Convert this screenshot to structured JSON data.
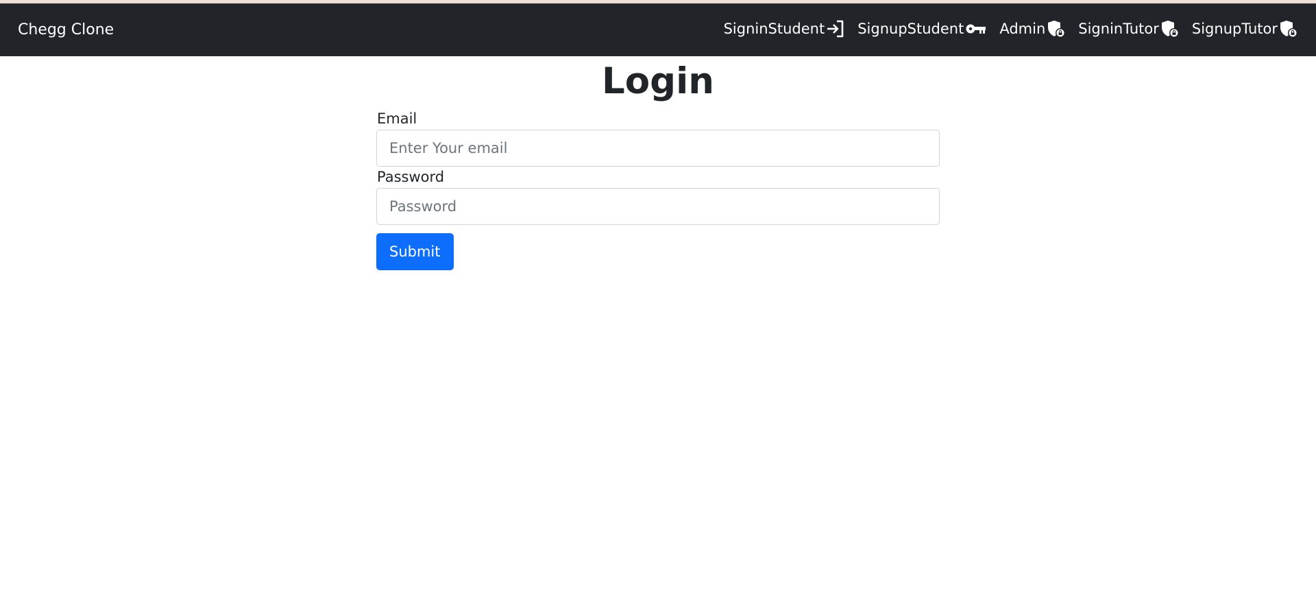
{
  "navbar": {
    "brand": "Chegg Clone",
    "links": [
      {
        "label": "SigninStudent",
        "icon": "sign-in-icon"
      },
      {
        "label": "SignupStudent",
        "icon": "key-icon"
      },
      {
        "label": "Admin",
        "icon": "shield-lock-icon"
      },
      {
        "label": "SigninTutor",
        "icon": "shield-lock-icon"
      },
      {
        "label": "SignupTutor",
        "icon": "shield-lock-icon"
      }
    ]
  },
  "page": {
    "title": "Login"
  },
  "form": {
    "email_label": "Email",
    "email_placeholder": "Enter Your email",
    "email_value": "",
    "password_label": "Password",
    "password_placeholder": "Password",
    "password_value": "",
    "submit_label": "Submit"
  },
  "colors": {
    "navbar_bg": "#212529",
    "primary": "#0d6efd",
    "top_strip": "#f2ddd2"
  }
}
